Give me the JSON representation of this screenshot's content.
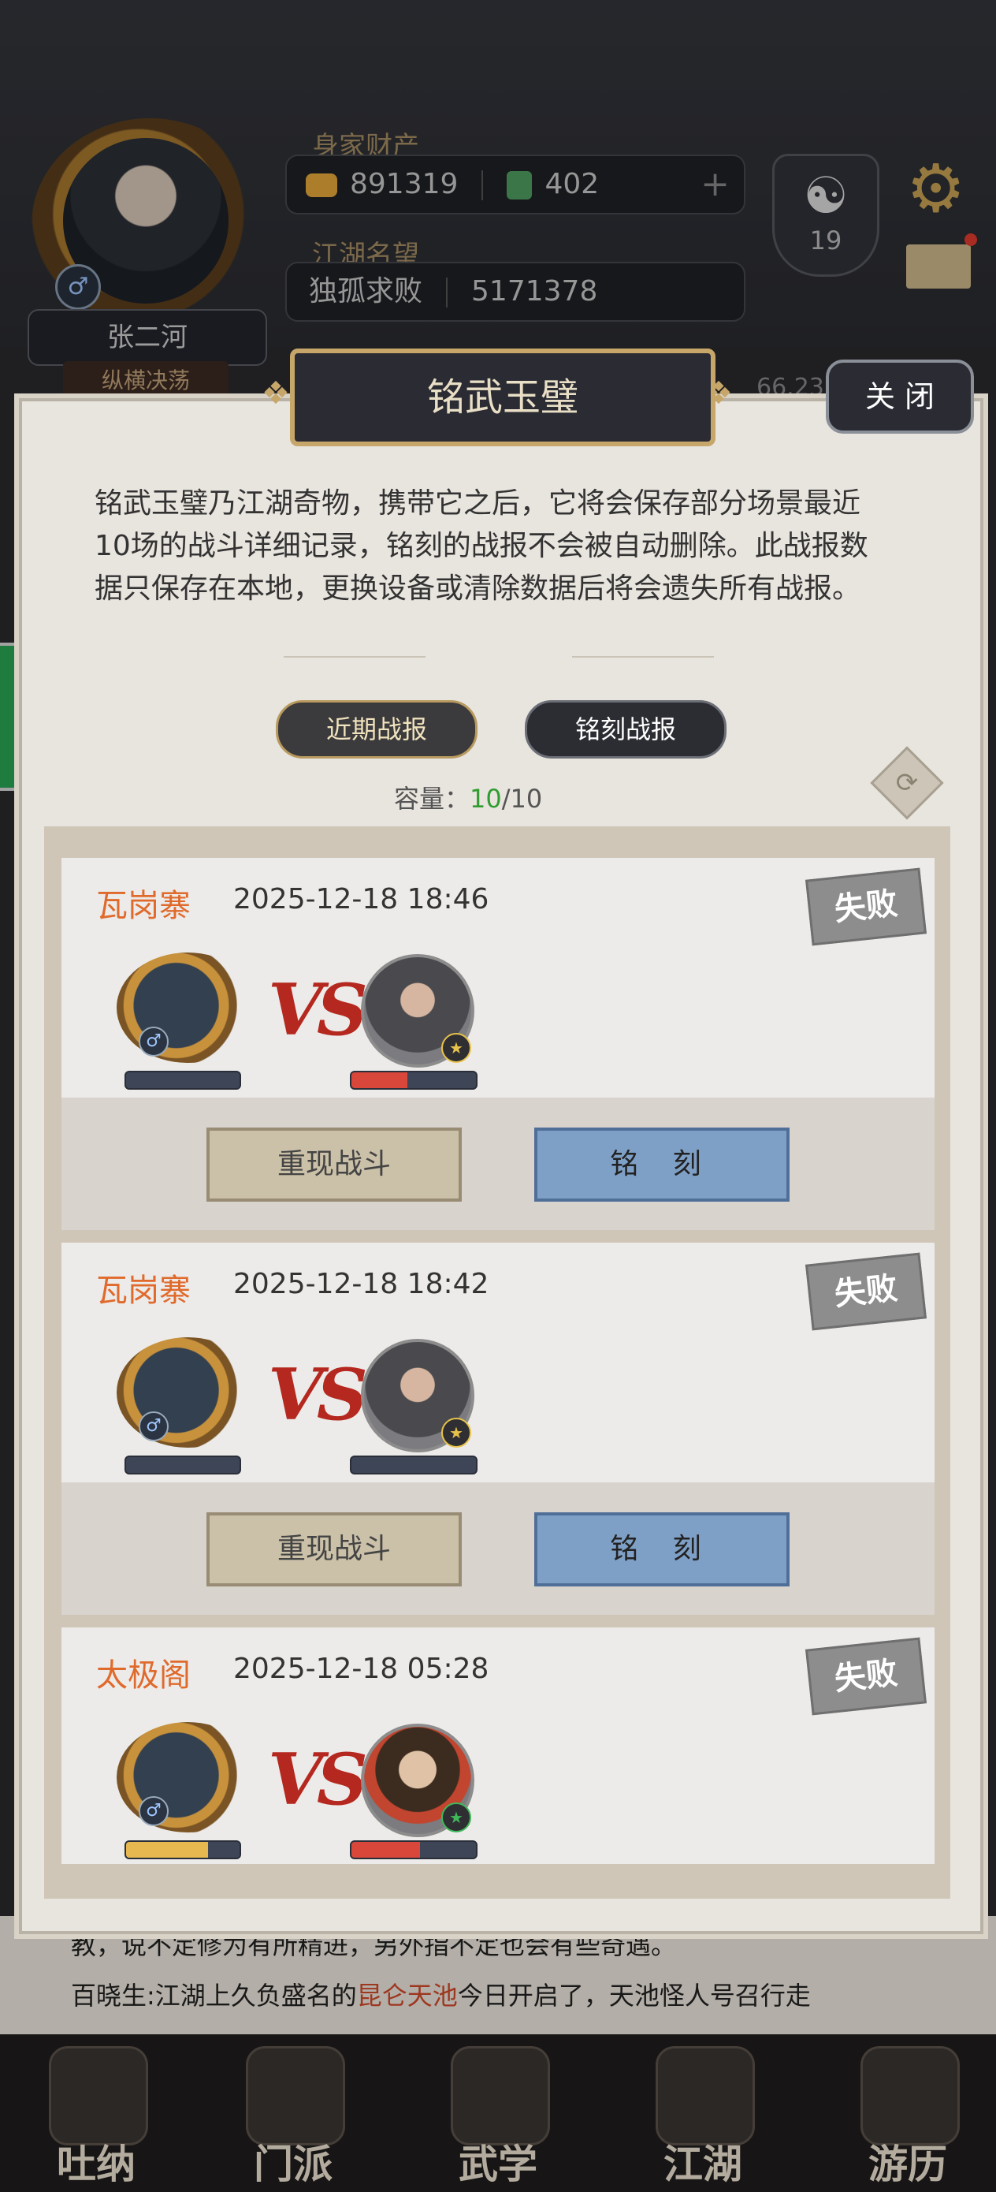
{
  "player": {
    "name": "张二河",
    "rank_title": "纵横决荡",
    "gender_symbol": "♂"
  },
  "wealth": {
    "label": "身家财产",
    "gold": "891319",
    "jade": "402",
    "plus": "+"
  },
  "fame": {
    "label": "江湖名望",
    "title": "独孤求败",
    "value": "5171378"
  },
  "taiji": {
    "symbol": "☯",
    "level": "19"
  },
  "background_peek": "66.23",
  "modal": {
    "title": "铭武玉璧",
    "close": "关 闭",
    "description": "铭武玉璧乃江湖奇物，携带它之后，它将会保存部分场景最近10场的战斗详细记录，铭刻的战报不会被自动删除。此战报数据只保存在本地，更换设备或清除数据后将会遗失所有战报。",
    "tabs": [
      "近期战报",
      "铭刻战报"
    ],
    "capacity_label": "容量：",
    "capacity_used": "10",
    "capacity_total": "/10",
    "refresh_symbol": "⟳"
  },
  "battles": [
    {
      "place": "瓦岗寨",
      "time": "2025-12-18 18:46",
      "result": "失败",
      "player_hp": 0,
      "enemy_hp": 0.45,
      "enemy_rank_color": "#e7c24a"
    },
    {
      "place": "瓦岗寨",
      "time": "2025-12-18 18:42",
      "result": "失败",
      "player_hp": 0,
      "enemy_hp": 0,
      "enemy_rank_color": "#e7c24a"
    },
    {
      "place": "太极阁",
      "time": "2025-12-18 05:28",
      "result": "失败",
      "player_hp": 0.72,
      "enemy_hp": 0.55,
      "enemy_rank_color": "#3fb85a"
    }
  ],
  "buttons": {
    "replay": "重现战斗",
    "engrave": "铭 刻"
  },
  "vs_text": "VS",
  "chat": {
    "line1": "教，说不定修为有所精进，另外指不定也会有些奇遇。",
    "line2_prefix": "百晓生:江湖上久负盛名的",
    "line2_highlight": "昆仑天池",
    "line2_suffix": "今日开启了，天池怪人号召行走"
  },
  "nav": [
    "吐纳",
    "门派",
    "武学",
    "江湖",
    "游历"
  ],
  "colors": {
    "accent_gold": "#c7a66a",
    "place_orange": "#e06a2c",
    "hp_red": "#d8473a",
    "hp_gold": "#e6b84f"
  }
}
